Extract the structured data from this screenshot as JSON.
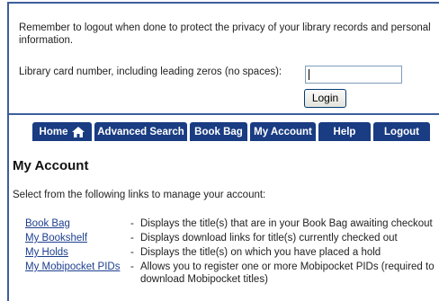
{
  "login": {
    "notice": "Remember to logout when done to protect the privacy of your library records and personal information.",
    "card_label": "Library card number, including leading zeros (no spaces):",
    "card_value": "",
    "login_label": "Login"
  },
  "nav": {
    "home": "Home",
    "advanced_search": "Advanced Search",
    "book_bag": "Book Bag",
    "my_account": "My Account",
    "help": "Help",
    "logout": "Logout",
    "color": "#193c82"
  },
  "main": {
    "title": "My Account",
    "intro": "Select from the following links to manage your account:",
    "links": [
      {
        "label": "Book Bag",
        "desc": "Displays the title(s) that are in your Book Bag awaiting checkout"
      },
      {
        "label": "My Bookshelf",
        "desc": "Displays download links for title(s) currently checked out"
      },
      {
        "label": "My Holds",
        "desc": "Displays the title(s) on which you have placed a hold"
      },
      {
        "label": "My Mobipocket PIDs",
        "desc": "Allows you to register one or more Mobipocket PIDs (required to download Mobipocket titles)"
      }
    ]
  }
}
